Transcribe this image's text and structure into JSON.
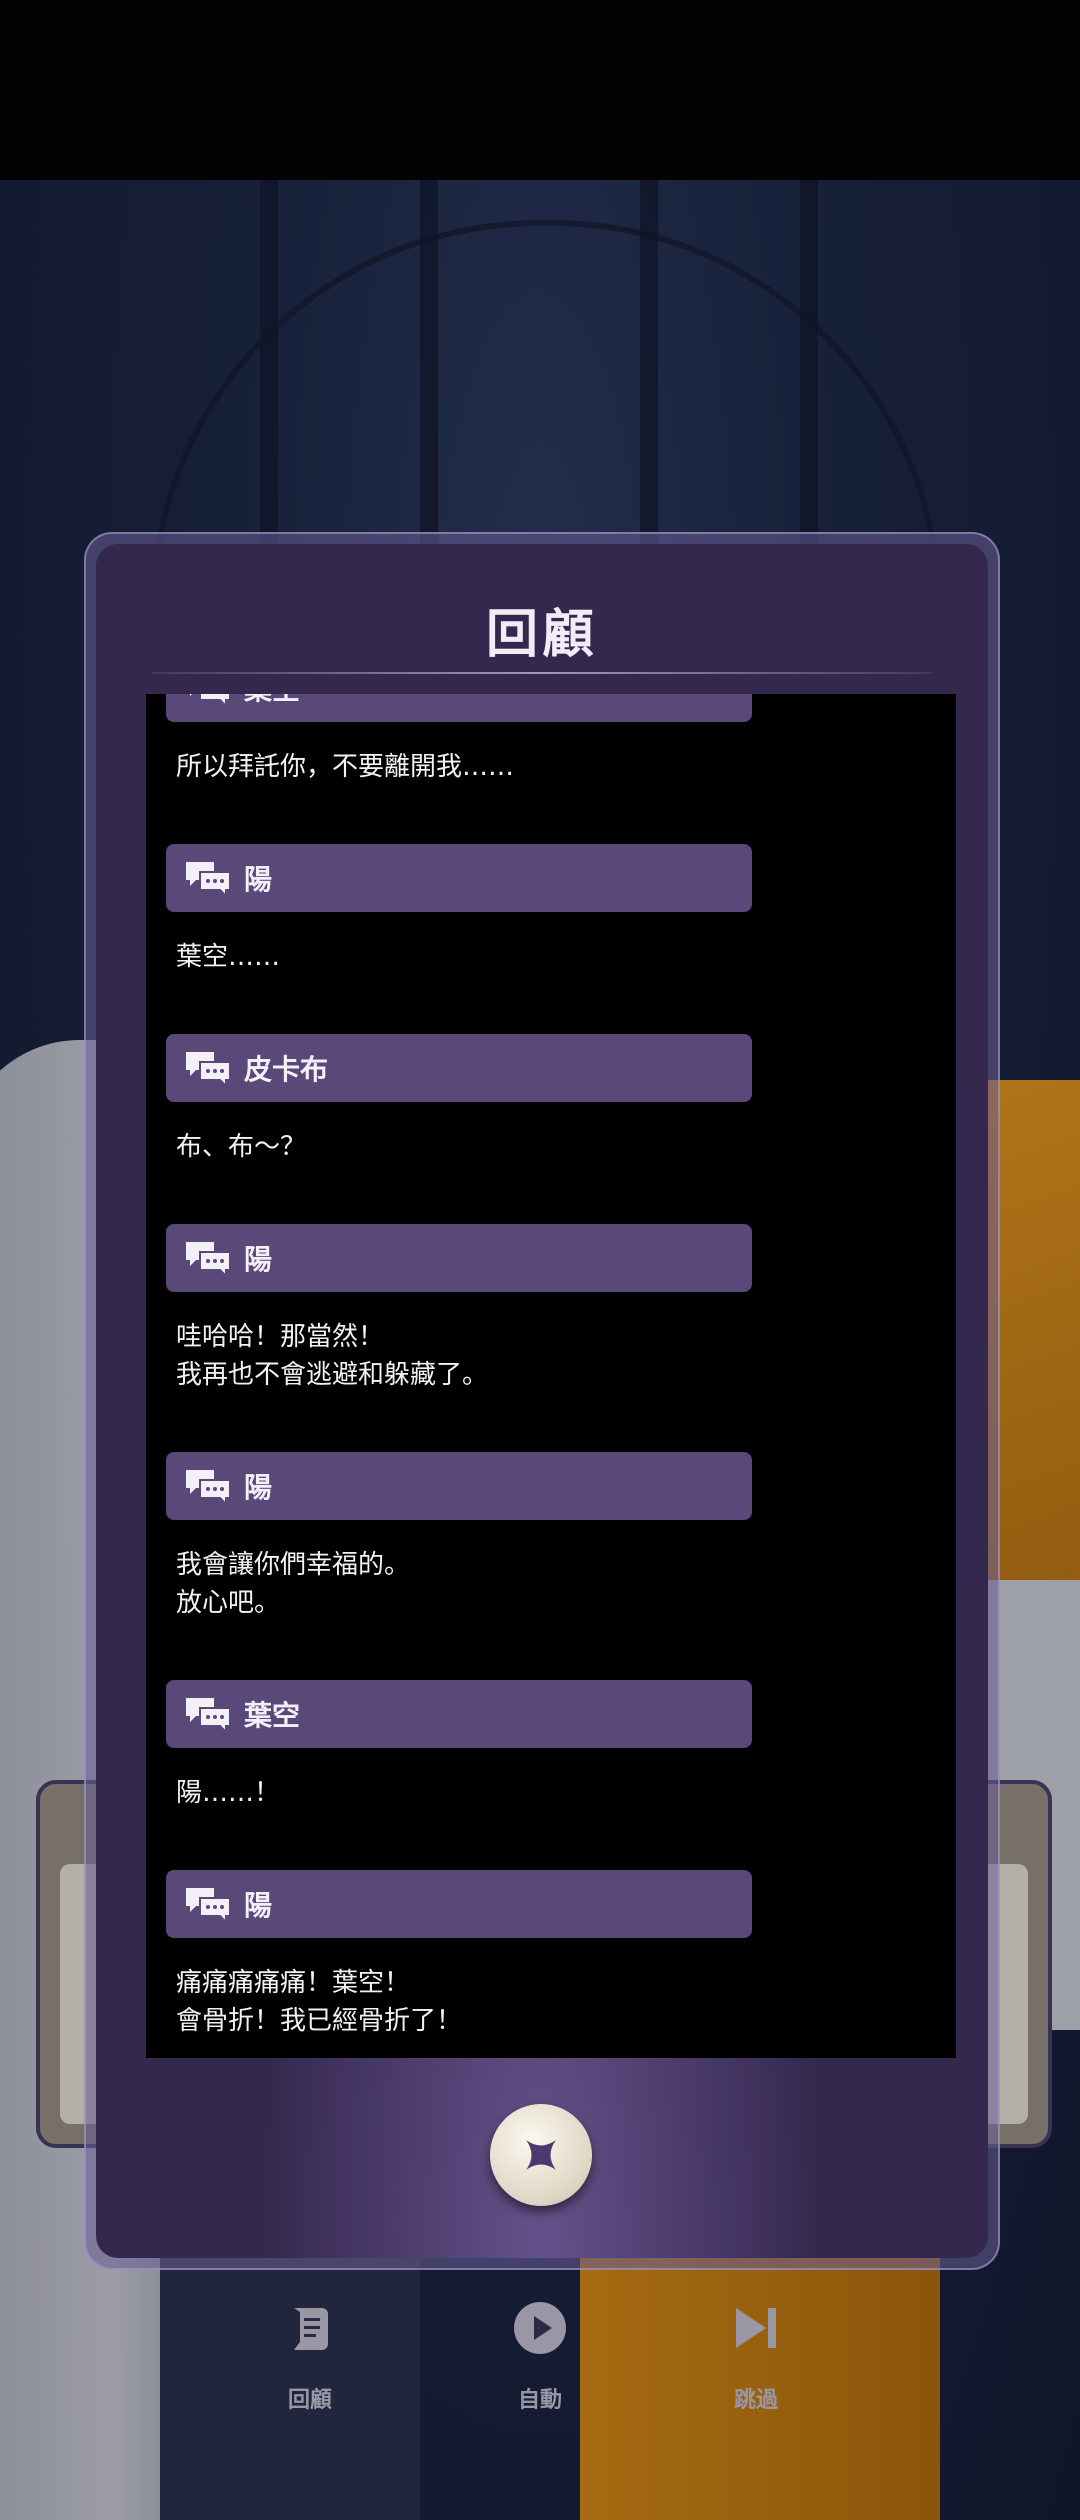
{
  "dialog": {
    "title": "回顧",
    "close_label": "×"
  },
  "log_entries": [
    {
      "speaker": "葉空",
      "lines": [
        "所以拜託你，不要離開我……"
      ]
    },
    {
      "speaker": "陽",
      "lines": [
        "葉空……"
      ]
    },
    {
      "speaker": "皮卡布",
      "lines": [
        "布、布～？"
      ]
    },
    {
      "speaker": "陽",
      "lines": [
        "哇哈哈！那當然！",
        "我再也不會逃避和躲藏了。"
      ]
    },
    {
      "speaker": "陽",
      "lines": [
        "我會讓你們幸福的。",
        "放心吧。"
      ]
    },
    {
      "speaker": "葉空",
      "lines": [
        "陽……！"
      ]
    },
    {
      "speaker": "陽",
      "lines": [
        "痛痛痛痛痛！葉空！",
        "會骨折！我已經骨折了！"
      ]
    }
  ],
  "bottom_menu": [
    {
      "label": "回顧",
      "icon": "scroll-icon"
    },
    {
      "label": "自動",
      "icon": "play-icon"
    },
    {
      "label": "跳過",
      "icon": "skip-icon"
    }
  ],
  "colors": {
    "speaker_bar": "#5a4878",
    "panel": "#2c2345",
    "close_x": "#4a3a6e"
  }
}
